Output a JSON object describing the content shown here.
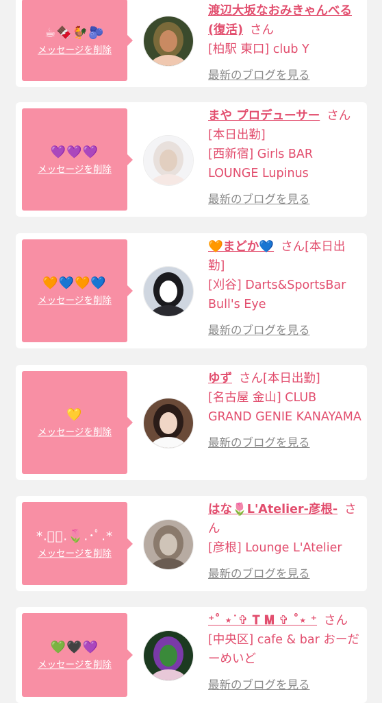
{
  "colors": {
    "background": "#f2f2f2",
    "card": "#ffffff",
    "message_box": "#f88fa4",
    "name": "#e24e6e",
    "blog_link": "#8a8a8a"
  },
  "entries": [
    {
      "message": "☕🍫🐓🫐",
      "delete_label": "メッセージを削除",
      "name": "渡辺大坂なおみきゃんべる(復活)",
      "suffix": "さん",
      "shop": "[柏駅 東口] club Y",
      "blog_label": "最新のブログを見る",
      "avatar_icon": "woman-photo-icon",
      "avatar_colors": [
        "#3a4a2c",
        "#7a6a3a",
        "#c98a62",
        "#f0c8b0"
      ]
    },
    {
      "message": "💜💜💜",
      "delete_label": "メッセージを削除",
      "name": "まや プロデューサー",
      "suffix": "さん[本日出勤]",
      "shop": "[西新宿] Girls BAR LOUNGE Lupinus",
      "blog_label": "最新のブログを見る",
      "avatar_icon": "woman-photo-icon",
      "avatar_colors": [
        "#f4f4f6",
        "#e8e0dc",
        "#e2cfc0",
        "#f6e8e4"
      ]
    },
    {
      "message": "🧡💙🧡💙",
      "delete_label": "メッセージを削除",
      "name": "🧡まどか💙",
      "suffix": "さん[本日出勤]",
      "shop": "[刈谷] Darts&SportsBar Bull's Eye",
      "blog_label": "最新のブログを見る",
      "avatar_icon": "woman-photo-icon",
      "avatar_colors": [
        "#cfd6e0",
        "#1a1a1e",
        "#ffffff",
        "#2a2a30"
      ]
    },
    {
      "message": "💛",
      "delete_label": "メッセージを削除",
      "name": "ゆず",
      "suffix": "さん[本日出勤]",
      "shop": "[名古屋 金山] CLUB GRAND GENIE KANAYAMA",
      "blog_label": "最新のブログを見る",
      "avatar_icon": "woman-photo-icon",
      "avatar_colors": [
        "#6a4a38",
        "#2a1c18",
        "#f0d6c6",
        "#fafafa"
      ]
    },
    {
      "message": "*.ﾟ･.🌷.･ﾟ.*",
      "delete_label": "メッセージを削除",
      "name": "はな🌷L'Atelier-彦根-",
      "suffix": "さん",
      "shop": "[彦根] Lounge L'Atelier",
      "blog_label": "最新のブログを見る",
      "avatar_icon": "hair-photo-icon",
      "avatar_colors": [
        "#b7aba2",
        "#8a7a6c",
        "#cfc4b8",
        "#6a5c52"
      ]
    },
    {
      "message": "💚🖤💜",
      "delete_label": "メッセージを削除",
      "name": "⁺˚ ⋆˙✞ 𝐓 𝐌 ✞ ˚⋆ ⁺",
      "suffix": "さん",
      "shop": "[中央区] cafe & bar おーだーめいど",
      "blog_label": "最新のブログを見る",
      "avatar_icon": "woman-photo-icon",
      "avatar_colors": [
        "#1c3a20",
        "#7a3aa8",
        "#3a8a3a",
        "#e8c8d8"
      ]
    }
  ]
}
